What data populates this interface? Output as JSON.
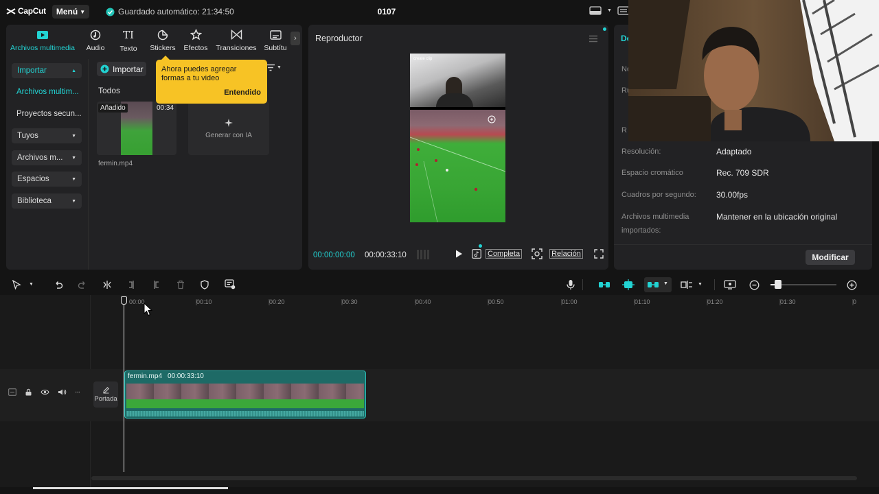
{
  "titlebar": {
    "logo": "CapCut",
    "menu_label": "Menú",
    "autosave": "Guardado automático: 21:34:50",
    "project_name": "0107"
  },
  "media": {
    "tabs": [
      {
        "label": "Archivos multimedia",
        "icon": "media-icon",
        "active": true
      },
      {
        "label": "Audio",
        "icon": "audio-icon"
      },
      {
        "label": "Texto",
        "icon": "text-icon"
      },
      {
        "label": "Stickers",
        "icon": "sticker-icon"
      },
      {
        "label": "Efectos",
        "icon": "effects-icon"
      },
      {
        "label": "Transiciones",
        "icon": "transitions-icon"
      },
      {
        "label": "Subtítu",
        "icon": "subtitles-icon"
      }
    ],
    "sidebar": {
      "importar": "Importar",
      "archivos": "Archivos multim...",
      "proyectos": "Proyectos secun...",
      "tuyos": "Tuyos",
      "archivos_m": "Archivos m...",
      "espacios": "Espacios",
      "biblioteca": "Biblioteca"
    },
    "import_button": "Importar",
    "todos": "Todos",
    "item": {
      "badge": "Añadido",
      "duration": "00:34",
      "filename": "fermin.mp4"
    },
    "generate_ai": "Generar con IA",
    "tooltip": {
      "text": "Ahora puedes agregar formas a tu video",
      "button": "Entendido"
    }
  },
  "player": {
    "title": "Reproductor",
    "current_time": "00:00:00:00",
    "total_time": "00:00:33:10",
    "complete_label": "Completa",
    "ratio_label": "Relación",
    "video_watermark": "create clip"
  },
  "details": {
    "title_partial": "De",
    "rows": [
      {
        "label": "Resolución:",
        "value": "Adaptado"
      },
      {
        "label": "Espacio cromático",
        "value": "Rec. 709 SDR"
      },
      {
        "label": "Cuadros por segundo:",
        "value": "30.00fps"
      },
      {
        "label": "Archivos multimedia importados:",
        "value": "Mantener en la ubicación original"
      }
    ],
    "partial_labels": [
      "No",
      "Ru",
      "R"
    ],
    "modify_button": "Modificar"
  },
  "timeline": {
    "ticks": [
      "00:00",
      "00:10",
      "00:20",
      "00:30",
      "00:40",
      "00:50",
      "01:00",
      "01:10",
      "01:20",
      "01:30",
      "0"
    ],
    "cover_label": "Portada",
    "clip": {
      "name": "fermin.mp4",
      "duration": "00:00:33:10"
    }
  },
  "colors": {
    "accent": "#22d3d3",
    "tooltip": "#f7c325",
    "clip": "#1e6a66"
  }
}
